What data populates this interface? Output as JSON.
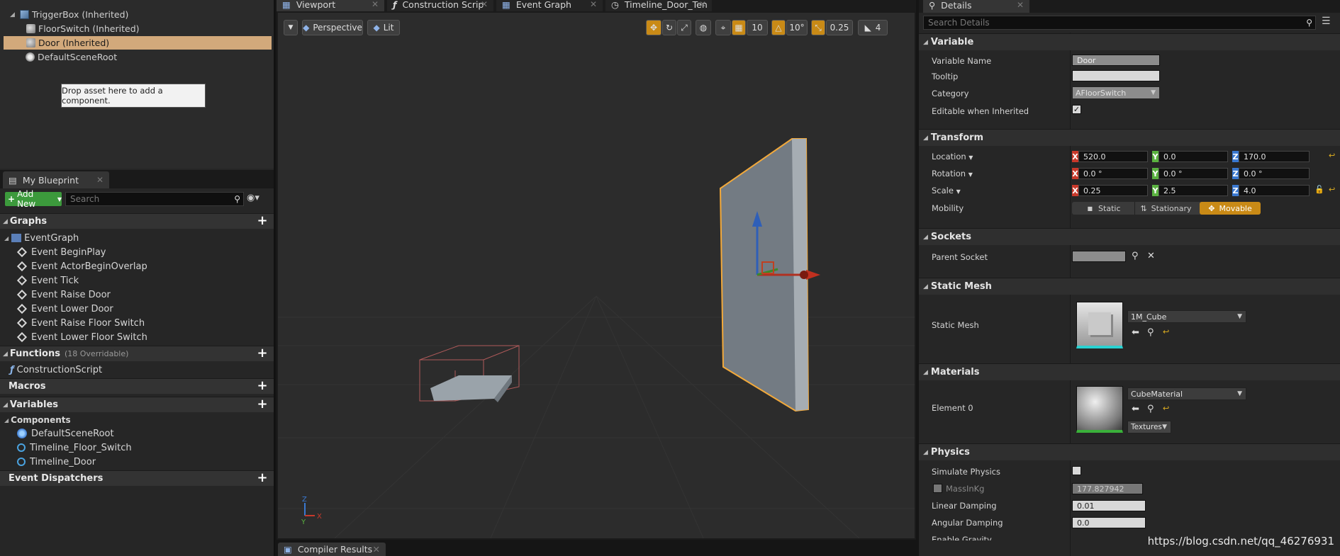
{
  "components": {
    "items": [
      {
        "label": "TriggerBox (Inherited)",
        "icon": "box-icon"
      },
      {
        "label": "FloorSwitch (Inherited)",
        "icon": "mesh-icon"
      },
      {
        "label": "Door (Inherited)",
        "icon": "mesh-icon"
      },
      {
        "label": "DefaultSceneRoot",
        "icon": "scene-root-icon"
      }
    ],
    "drop_hint": "Drop asset here to add a component."
  },
  "my_blueprint": {
    "tab_label": "My Blueprint",
    "add_new_label": "Add New",
    "search_placeholder": "Search",
    "graphs_label": "Graphs",
    "event_graph_label": "EventGraph",
    "events": [
      "Event BeginPlay",
      "Event ActorBeginOverlap",
      "Event Tick",
      "Event Raise Door",
      "Event Lower Door",
      "Event Raise Floor Switch",
      "Event Lower Floor Switch"
    ],
    "functions_label": "Functions",
    "functions_count": "(18 Overridable)",
    "construction_script": "ConstructionScript",
    "macros_label": "Macros",
    "variables_label": "Variables",
    "components_label": "Components",
    "component_vars": [
      "DefaultSceneRoot",
      "Timeline_Floor_Switch",
      "Timeline_Door"
    ],
    "dispatchers_label": "Event Dispatchers"
  },
  "editor_tabs": [
    "Viewport",
    "Construction Scrip",
    "Event Graph",
    "Timeline_Door_Ten"
  ],
  "viewport": {
    "perspective_label": "Perspective",
    "lit_label": "Lit",
    "grid_snap": "10",
    "rotation_snap": "10°",
    "scale_snap": "0.25",
    "camera_speed": "4"
  },
  "details": {
    "tab_label": "Details",
    "search_placeholder": "Search Details",
    "variable": {
      "header": "Variable",
      "name_label": "Variable Name",
      "name_value": "Door",
      "tooltip_label": "Tooltip",
      "tooltip_value": "",
      "category_label": "Category",
      "category_value": "AFloorSwitch",
      "editable_label": "Editable when Inherited",
      "editable_checked": "✓"
    },
    "transform": {
      "header": "Transform",
      "location_label": "Location",
      "location": [
        "520.0",
        "0.0",
        "170.0"
      ],
      "rotation_label": "Rotation",
      "rotation": [
        "0.0 °",
        "0.0 °",
        "0.0 °"
      ],
      "scale_label": "Scale",
      "scale": [
        "0.25",
        "2.5",
        "4.0"
      ],
      "mobility_label": "Mobility",
      "mobility_options": [
        "Static",
        "Stationary",
        "Movable"
      ],
      "mobility_selected": "Movable"
    },
    "sockets": {
      "header": "Sockets",
      "parent_label": "Parent Socket"
    },
    "static_mesh": {
      "header": "Static Mesh",
      "label": "Static Mesh",
      "value": "1M_Cube"
    },
    "materials": {
      "header": "Materials",
      "element_label": "Element 0",
      "value": "CubeMaterial",
      "textures_label": "Textures"
    },
    "physics": {
      "header": "Physics",
      "simulate_label": "Simulate Physics",
      "mass_label": "MassInKg",
      "mass_value": "177.827942",
      "linear_label": "Linear Damping",
      "linear_value": "0.01",
      "angular_label": "Angular Damping",
      "angular_value": "0.0",
      "gravity_label": "Enable Gravity"
    }
  },
  "compiler_tab": "Compiler Results",
  "watermark": "https://blog.csdn.net/qq_46276931",
  "colors": {
    "selection": "#d2a97b",
    "accent_orange": "#c98a16",
    "green_button": "#3c9a3c"
  }
}
